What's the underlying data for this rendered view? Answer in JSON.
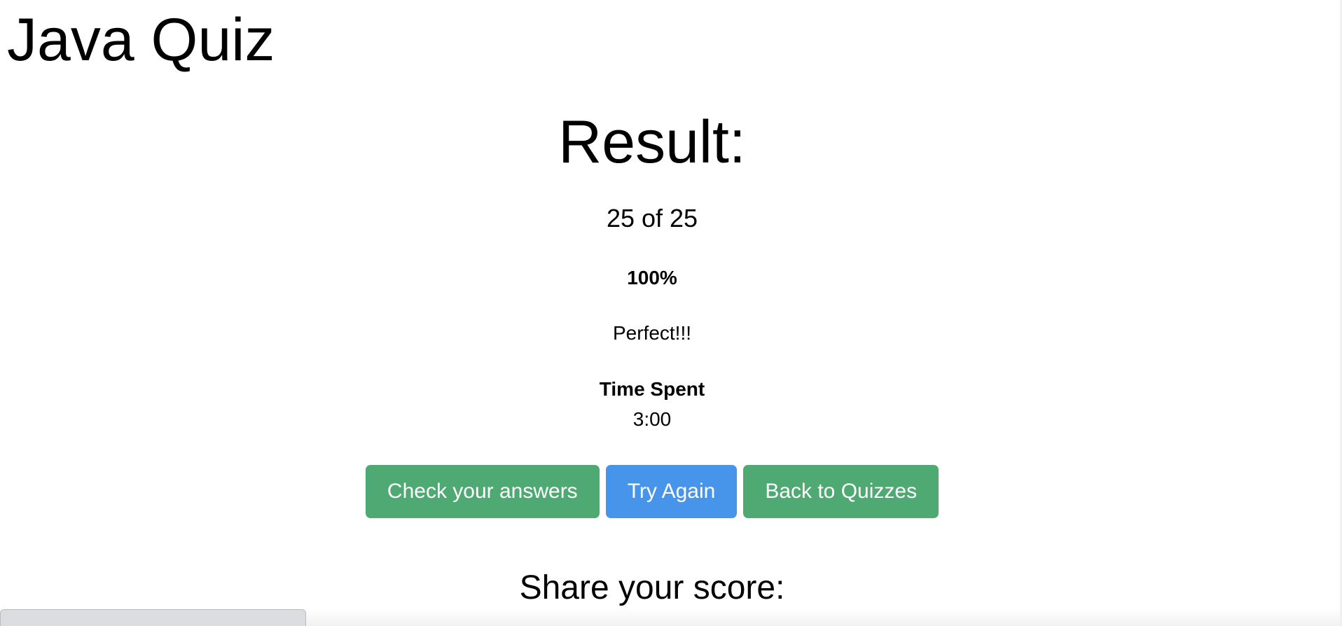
{
  "header": {
    "title": "Java Quiz"
  },
  "result": {
    "heading": "Result:",
    "score": "25 of 25",
    "percent": "100%",
    "message": "Perfect!!!",
    "time_label": "Time Spent",
    "time_value": "3:00"
  },
  "actions": {
    "check_answers_label": "Check your answers",
    "try_again_label": "Try Again",
    "back_label": "Back to Quizzes"
  },
  "share": {
    "heading": "Share your score:"
  },
  "colors": {
    "green_button": "#4ea972",
    "blue_button": "#4695ea"
  }
}
